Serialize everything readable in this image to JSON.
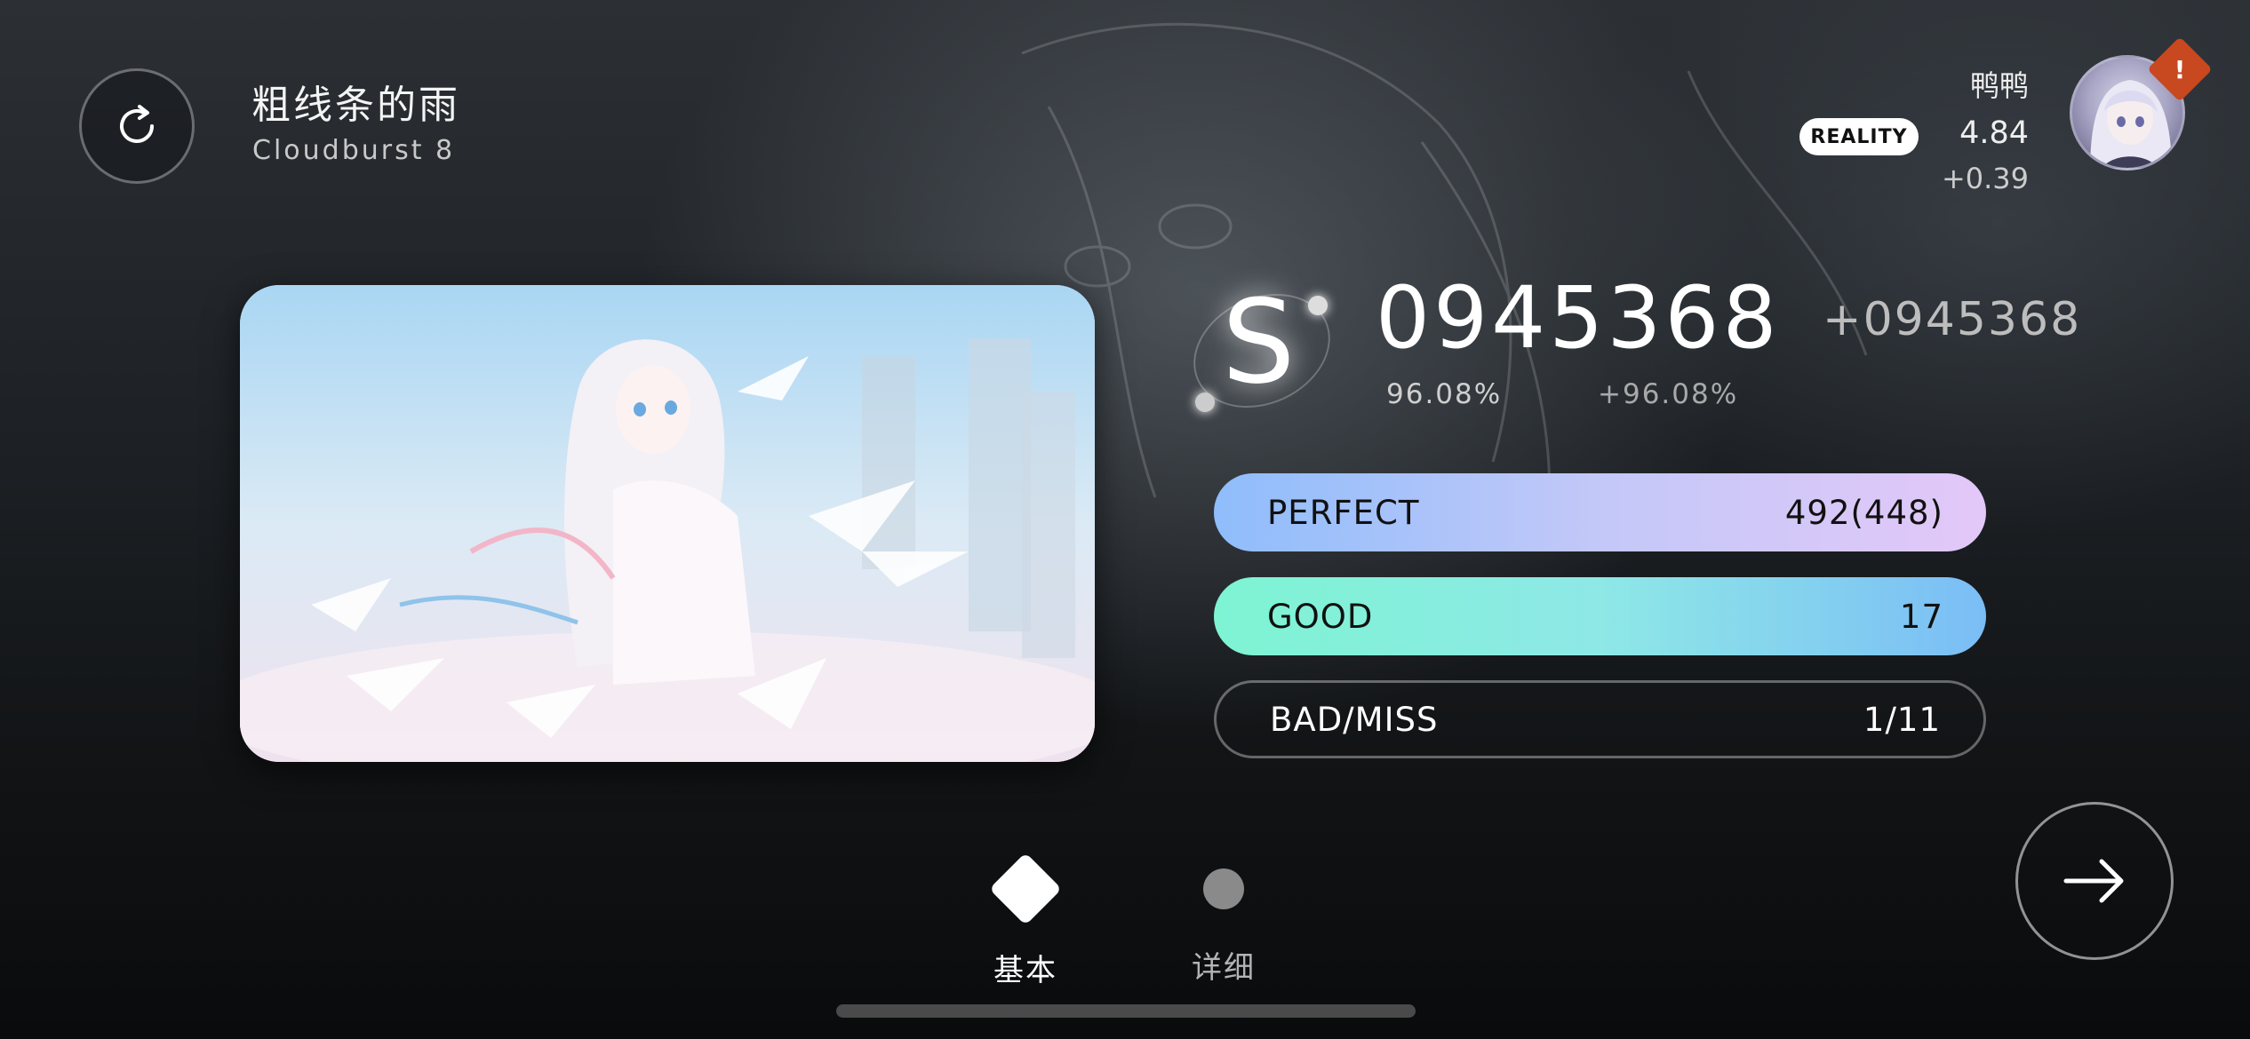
{
  "song": {
    "title": "粗线条的雨",
    "subtitle": "Cloudburst 8"
  },
  "player": {
    "name": "鸭鸭",
    "badge": "REALITY",
    "rks": "4.84",
    "rks_delta": "+0.39",
    "alert": "!"
  },
  "result": {
    "grade": "S",
    "score": "0945368",
    "score_delta": "+0945368",
    "accuracy": "96.08%",
    "accuracy_delta": "+96.08%"
  },
  "judgements": [
    {
      "label": "PERFECT",
      "value": "492(448)"
    },
    {
      "label": "GOOD",
      "value": "17"
    },
    {
      "label": "BAD/MISS",
      "value": "1/11"
    }
  ],
  "tabs": [
    {
      "label": "基本",
      "icon": "diamond-icon",
      "active": true
    },
    {
      "label": "详细",
      "icon": "dot-icon",
      "active": false
    }
  ],
  "colors": {
    "perfect_gradient": [
      "#8fbdfb",
      "#e3c8f8"
    ],
    "good_gradient": [
      "#7ef4d3",
      "#7bbdf6"
    ],
    "alert": "#c8481f"
  }
}
